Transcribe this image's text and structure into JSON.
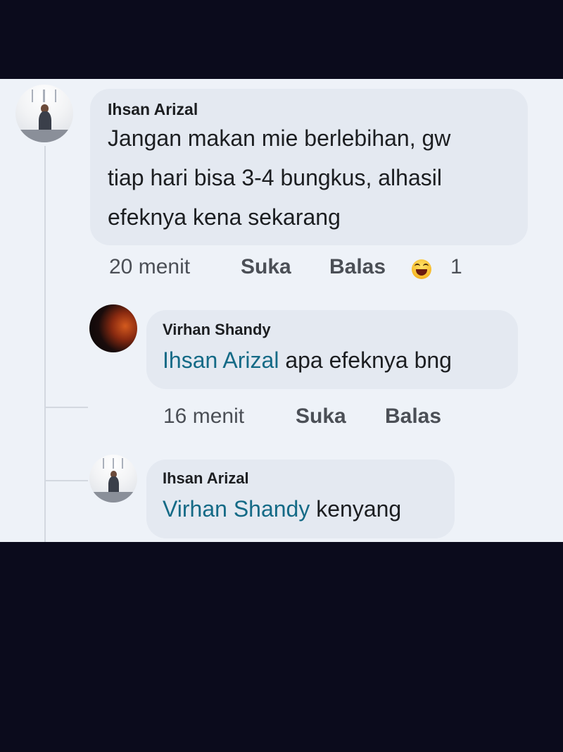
{
  "comments": [
    {
      "author": "Ihsan Arizal",
      "text_lines": [
        "Jangan makan mie berlebihan, gw",
        "tiap hari bisa 3-4 bungkus, alhasil",
        "efeknya kena sekarang"
      ],
      "time": "20 menit",
      "like_label": "Suka",
      "reply_label": "Balas",
      "reaction_icon": "laughing-emoji-icon",
      "reaction_count": "1"
    }
  ],
  "replies": [
    {
      "author": "Virhan Shandy",
      "mention": "Ihsan Arizal",
      "text": " apa efeknya bng",
      "time": "16 menit",
      "like_label": "Suka",
      "reply_label": "Balas"
    },
    {
      "author": "Ihsan Arizal",
      "mention": "Virhan Shandy",
      "text": " kenyang"
    }
  ]
}
